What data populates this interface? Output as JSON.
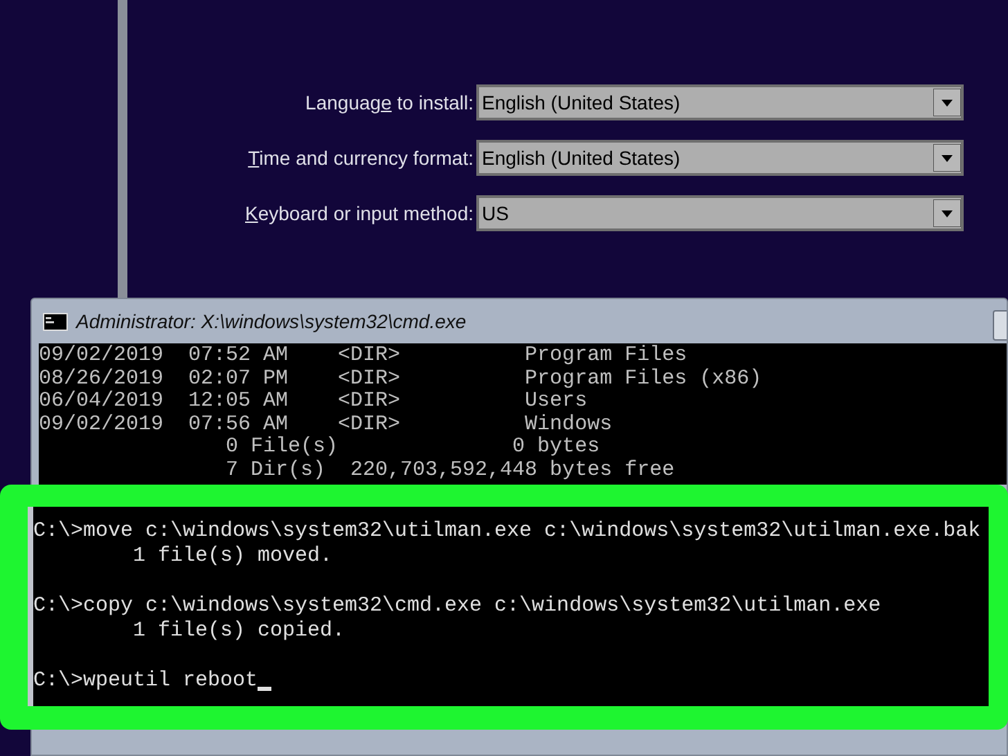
{
  "setup": {
    "fields": [
      {
        "label": {
          "before": "Languag",
          "hotkey": "e",
          "after": " to install:"
        },
        "value": "English (United States)"
      },
      {
        "label": {
          "hotkey": "T",
          "after": "ime and currency format:"
        },
        "value": "English (United States)"
      },
      {
        "label": {
          "hotkey": "K",
          "after": "eyboard or input method:"
        },
        "value": "US"
      }
    ]
  },
  "console": {
    "title": "Administrator: X:\\windows\\system32\\cmd.exe",
    "listing": [
      "09/02/2019  07:52 AM    <DIR>          Program Files",
      "08/26/2019  02:07 PM    <DIR>          Program Files (x86)",
      "06/04/2019  12:05 AM    <DIR>          Users",
      "09/02/2019  07:56 AM    <DIR>          Windows",
      "               0 File(s)              0 bytes",
      "               7 Dir(s)  220,703,592,448 bytes free"
    ],
    "highlighted_commands": [
      {
        "command": "C:\\>move c:\\windows\\system32\\utilman.exe c:\\windows\\system32\\utilman.exe.bak",
        "result": "        1 file(s) moved."
      },
      {
        "command": "C:\\>copy c:\\windows\\system32\\cmd.exe c:\\windows\\system32\\utilman.exe",
        "result": "        1 file(s) copied."
      },
      {
        "command": "C:\\>wpeutil reboot"
      }
    ]
  }
}
